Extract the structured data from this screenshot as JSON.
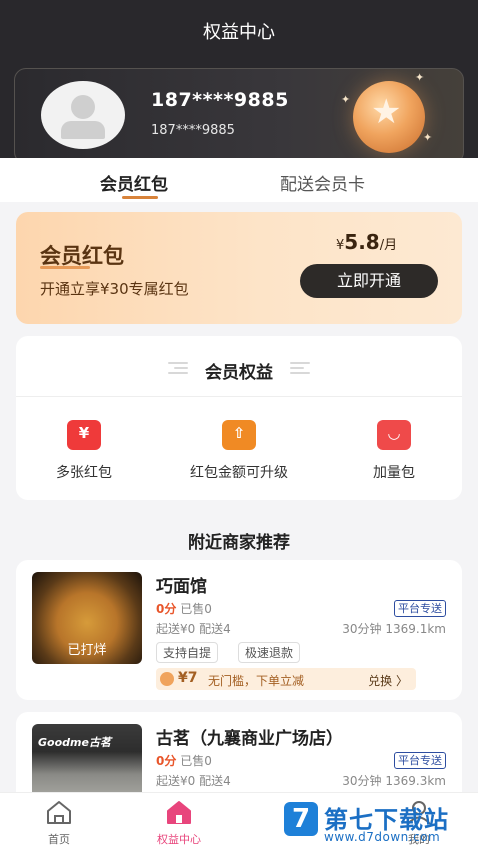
{
  "header": {
    "title": "权益中心"
  },
  "member": {
    "phone_main": "187****9885",
    "phone_sub": "187****9885"
  },
  "tabs": [
    {
      "label": "会员红包",
      "active": true
    },
    {
      "label": "配送会员卡",
      "active": false
    }
  ],
  "promo": {
    "title": "会员红包",
    "subtitle": "开通立享¥30专属红包",
    "price_currency": "¥",
    "price_value": "5.8",
    "price_unit": "/月",
    "button_label": "立即开通"
  },
  "rights": {
    "title": "会员权益",
    "items": [
      {
        "label": "多张红包",
        "icon": "red-envelope-icon",
        "glyph": "¥",
        "color": "#ef3a3a"
      },
      {
        "label": "红包金额可升级",
        "icon": "upgrade-icon",
        "glyph": "⇧",
        "color": "#f08a24"
      },
      {
        "label": "加量包",
        "icon": "gift-bag-icon",
        "glyph": "◡",
        "color": "#ef4a4a"
      }
    ]
  },
  "nearby": {
    "title": "附近商家推荐",
    "shops": [
      {
        "name": "巧面馆",
        "score": "0分",
        "sold": "已售0",
        "badge": "平台专送",
        "delivery": "起送¥0 配送4",
        "distance": "30分钟 1369.1km",
        "image_tag": "已打烊",
        "chips": [
          "支持自提",
          "极速退款"
        ],
        "coupon": {
          "amount": "¥7",
          "desc": "无门槛，下单立减",
          "action": "兑换 〉"
        }
      },
      {
        "name": "古茗（九襄商业广场店）",
        "score": "0分",
        "sold": "已售0",
        "badge": "平台专送",
        "delivery": "起送¥0 配送4",
        "distance": "30分钟 1369.3km",
        "image_sign": "Goodme古茗"
      }
    ]
  },
  "bottom_nav": [
    {
      "label": "首页",
      "icon": "home-icon",
      "active": false
    },
    {
      "label": "权益中心",
      "icon": "home-icon",
      "active": true
    },
    {
      "label": "我的",
      "icon": "profile-icon",
      "active": false
    }
  ],
  "watermark": {
    "logo": "7",
    "text": "第七下载站",
    "url": "www.d7down.com"
  },
  "colors": {
    "accent": "#d8833a",
    "active_nav": "#e8457c",
    "dark": "#29282c"
  }
}
